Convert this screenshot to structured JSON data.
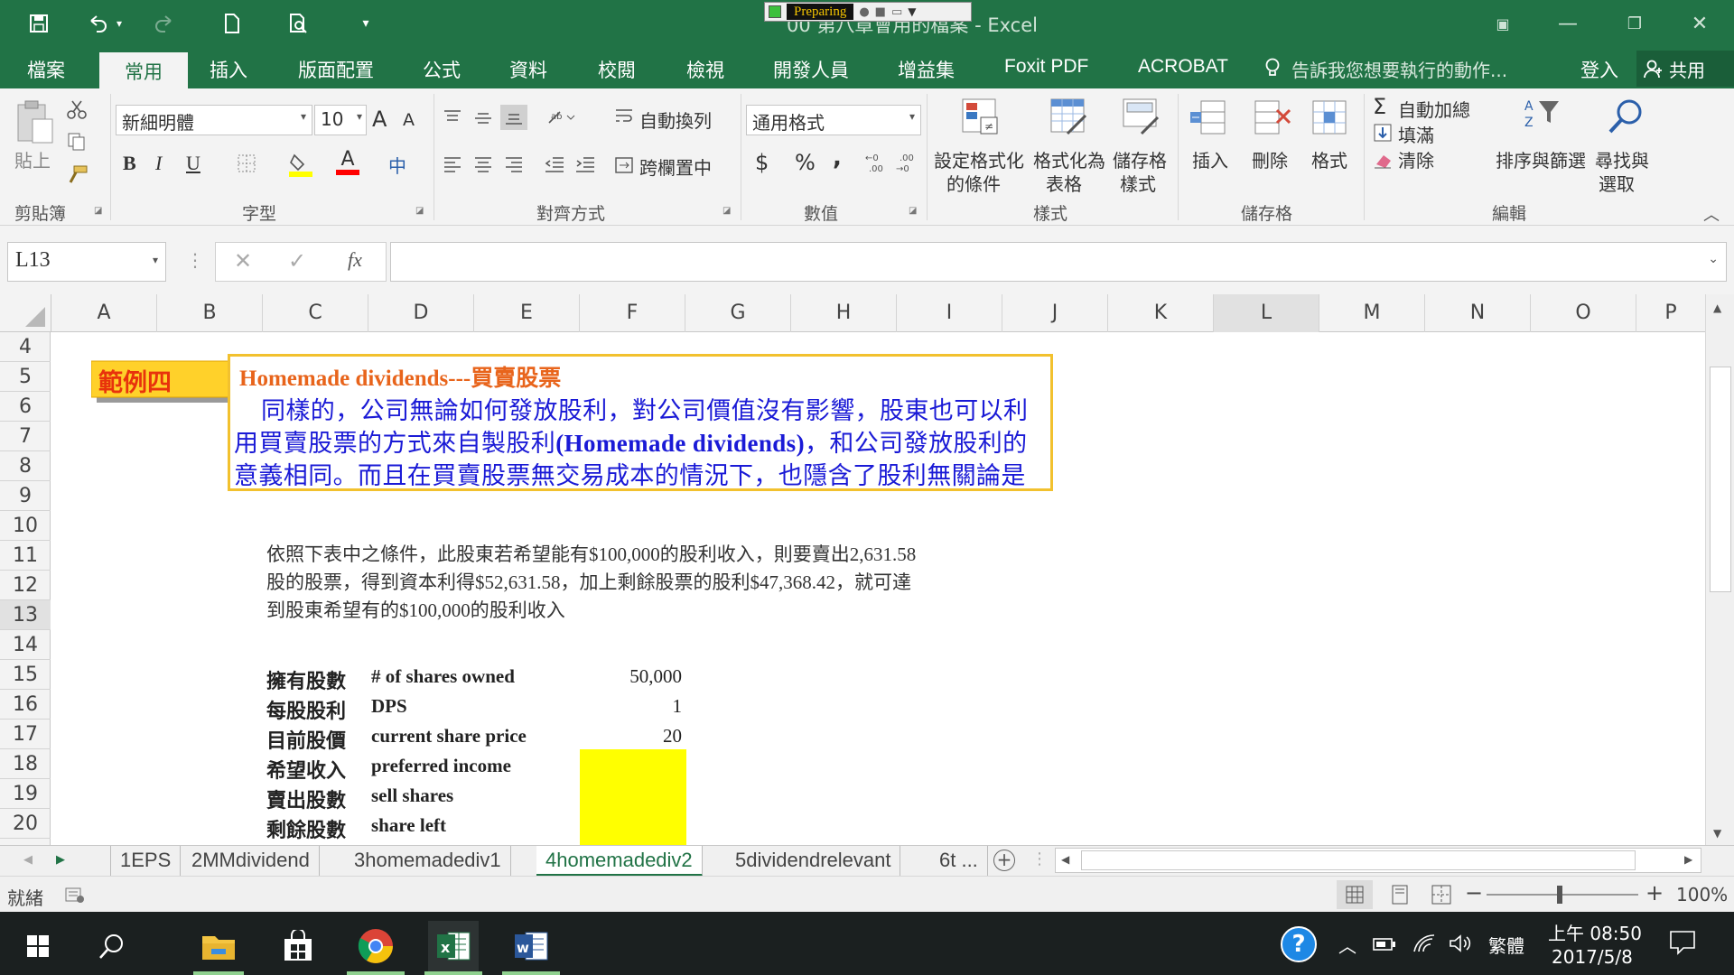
{
  "window": {
    "title": "00 第八章會用的檔案 - Excel",
    "recorder_status": "Preparing"
  },
  "tabs": [
    "檔案",
    "常用",
    "插入",
    "版面配置",
    "公式",
    "資料",
    "校閱",
    "檢視",
    "開發人員",
    "增益集",
    "Foxit PDF",
    "ACROBAT"
  ],
  "active_tab": "常用",
  "tell_me": "告訴我您想要執行的動作...",
  "account": {
    "signin": "登入",
    "share": "共用"
  },
  "ribbon": {
    "clipboard": {
      "label": "剪貼簿",
      "paste": "貼上"
    },
    "font": {
      "label": "字型",
      "name": "新細明體",
      "size": "10",
      "bold": "B",
      "italic": "I",
      "underline": "U",
      "grow": "A",
      "shrink": "A",
      "phonetic": "中",
      "font_color_letter": "A"
    },
    "alignment": {
      "label": "對齊方式",
      "wrap": "自動換列",
      "merge": "跨欄置中"
    },
    "number": {
      "label": "數值",
      "format": "通用格式",
      "currency": "$",
      "percent": "%",
      "comma": ","
    },
    "styles": {
      "label": "樣式",
      "conditional": [
        "設定格式化",
        "的條件"
      ],
      "as_table": [
        "格式化為",
        "表格"
      ],
      "cell_styles": [
        "儲存格",
        "樣式"
      ]
    },
    "cells": {
      "label": "儲存格",
      "insert": "插入",
      "delete": "刪除",
      "format": "格式"
    },
    "editing": {
      "label": "編輯",
      "autosum": "自動加總",
      "fill": "填滿",
      "clear": "清除",
      "sort": "排序與篩選",
      "find": [
        "尋找與",
        "選取"
      ]
    }
  },
  "formula_bar": {
    "name_box": "L13",
    "formula": "",
    "fx": "fx"
  },
  "columns": [
    "A",
    "B",
    "C",
    "D",
    "E",
    "F",
    "G",
    "H",
    "I",
    "J",
    "K",
    "L",
    "M",
    "N",
    "O",
    "P"
  ],
  "rows": [
    "4",
    "5",
    "6",
    "7",
    "8",
    "9",
    "10",
    "11",
    "12",
    "13",
    "14",
    "15",
    "16",
    "17",
    "18",
    "19",
    "20"
  ],
  "example_tag": "範例四",
  "callout": {
    "title": "Homemade dividends---買賣股票",
    "line1": "同樣的，公司無論如何發放股利，對公司價值沒有影響，股東也可以利",
    "line2_pre": "用買賣股票的方式來自製股利",
    "line2_bold": "(Homemade dividends)",
    "line2_post": "，和公司發放股利的",
    "line3": "意義相同。而且在買賣股票無交易成本的情況下，也隱含了股利無關論是"
  },
  "note": {
    "line1": "依照下表中之條件，此股東若希望能有$100,000的股利收入，則要賣出2,631.58",
    "line2": "股的股票，得到資本利得$52,631.58，加上剩餘股票的股利$47,368.42，就可達",
    "line3": "到股東希望有的$100,000的股利收入"
  },
  "table": [
    {
      "zh": "擁有股數",
      "en": "# of shares owned",
      "value": "50,000"
    },
    {
      "zh": "每股股利",
      "en": "DPS",
      "value": "1"
    },
    {
      "zh": "目前股價",
      "en": "current share price",
      "value": "20"
    },
    {
      "zh": "希望收入",
      "en": "preferred  income",
      "value": ""
    },
    {
      "zh": "賣出股數",
      "en": "sell shares",
      "value": ""
    },
    {
      "zh": "剩餘股數",
      "en": "share left",
      "value": ""
    }
  ],
  "sheet_tabs": [
    "1EPS",
    "2MMdividend",
    "3homemadediv1",
    "4homemadediv2",
    "5dividendrelevant",
    "6t ..."
  ],
  "active_sheet": "4homemadediv2",
  "status": {
    "ready": "就緒",
    "zoom": "100%"
  },
  "taskbar": {
    "time": "上午 08:50",
    "date": "2017/5/8",
    "ime": "繁體"
  },
  "colors": {
    "excel_green": "#217346",
    "highlight_yellow": "#ffff00",
    "callout_border": "#f2c12e",
    "title_orange": "#e8641b",
    "text_blue": "#1a1ad6"
  }
}
